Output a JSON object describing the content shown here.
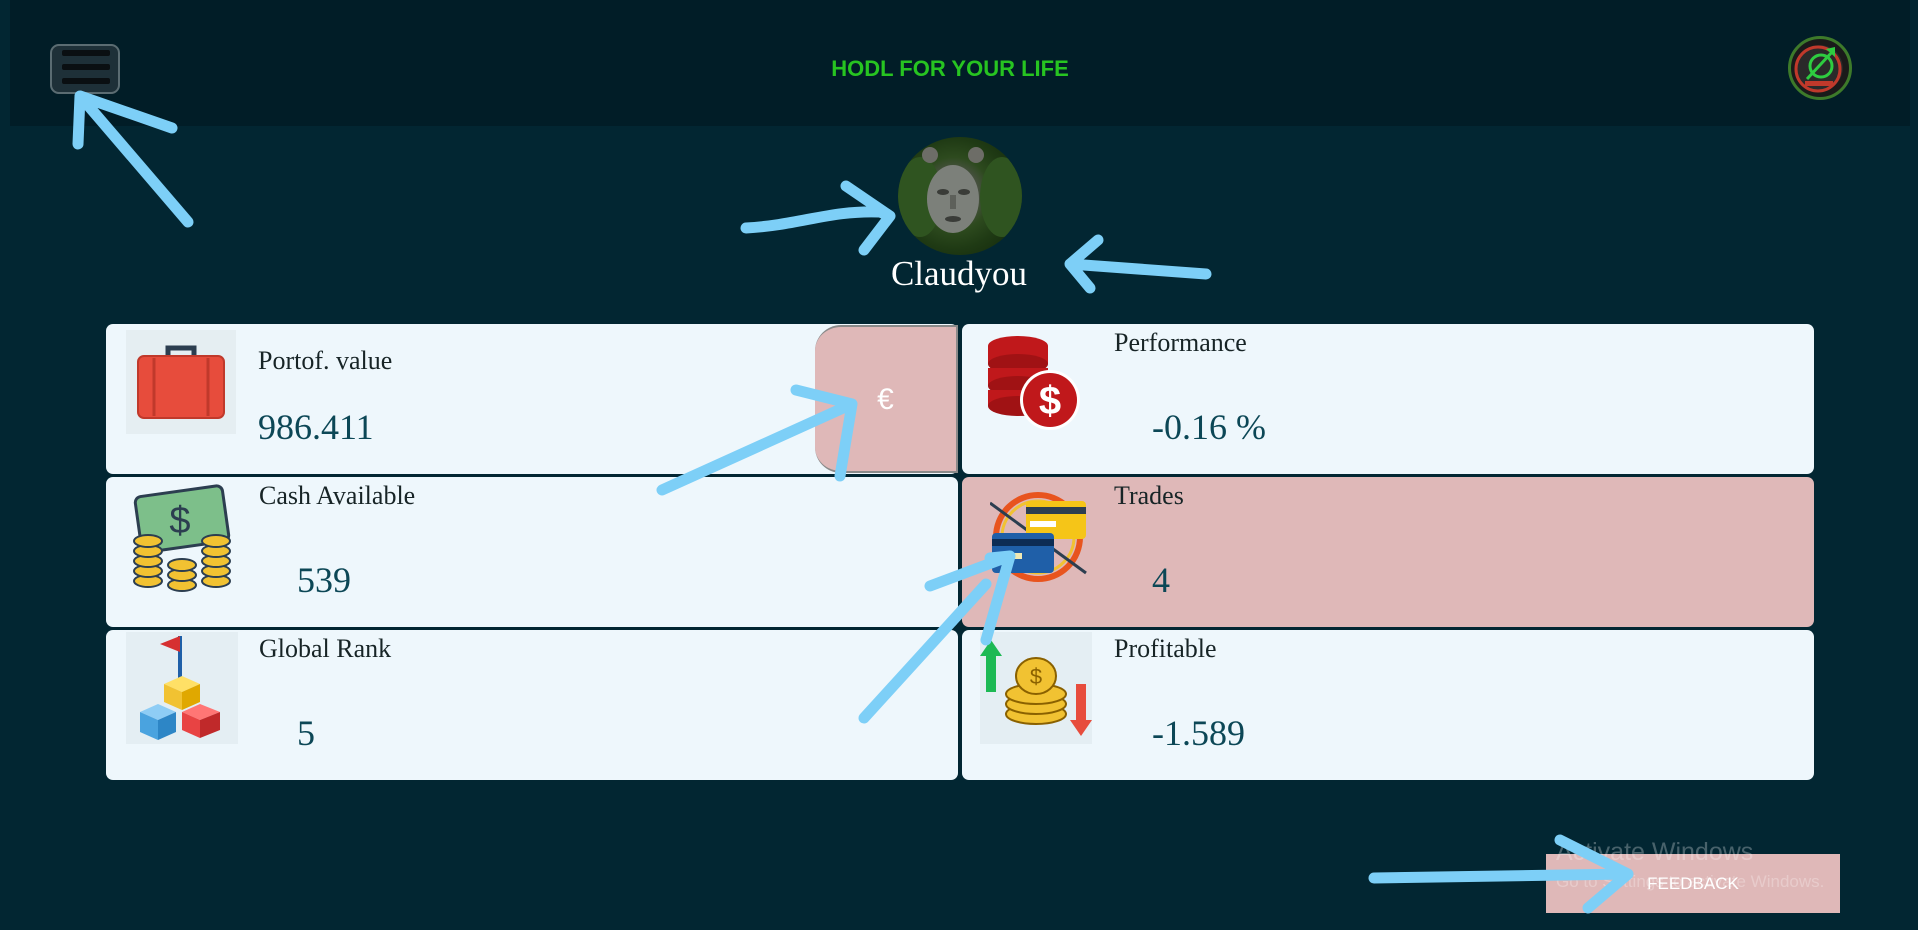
{
  "header": {
    "title": "HODL FOR YOUR LIFE",
    "menu_icon": "hamburger-menu-icon",
    "logo_icon": "app-logo-icon"
  },
  "profile": {
    "username": "Claudyou",
    "avatar_icon": "user-avatar"
  },
  "currency_button": "€",
  "cards": {
    "portfolio": {
      "label": "Portof. value",
      "value": "986.411",
      "icon": "briefcase-icon"
    },
    "performance": {
      "label": "Performance",
      "value": "-0.16 %",
      "icon": "coins-dollar-icon"
    },
    "cash": {
      "label": "Cash Available",
      "value": "539",
      "icon": "cash-coins-icon"
    },
    "trades": {
      "label": "Trades",
      "value": "4",
      "icon": "credit-cards-icon"
    },
    "rank": {
      "label": "Global Rank",
      "value": "5",
      "icon": "rank-blocks-icon"
    },
    "profitable": {
      "label": "Profitable",
      "value": "-1.589",
      "icon": "profit-coins-icon"
    }
  },
  "feedback_button": "FEEDBACK",
  "watermark": {
    "line1": "Activate Windows",
    "line2": "Go to Settings to activate Windows."
  },
  "colors": {
    "background": "#022632",
    "header_bg": "#011d27",
    "title_green": "#27c421",
    "card_bg": "#eef7fc",
    "card_highlight": "#dfb8b8",
    "value_text": "#0c4756",
    "annotation_arrow": "#7dcff7"
  }
}
